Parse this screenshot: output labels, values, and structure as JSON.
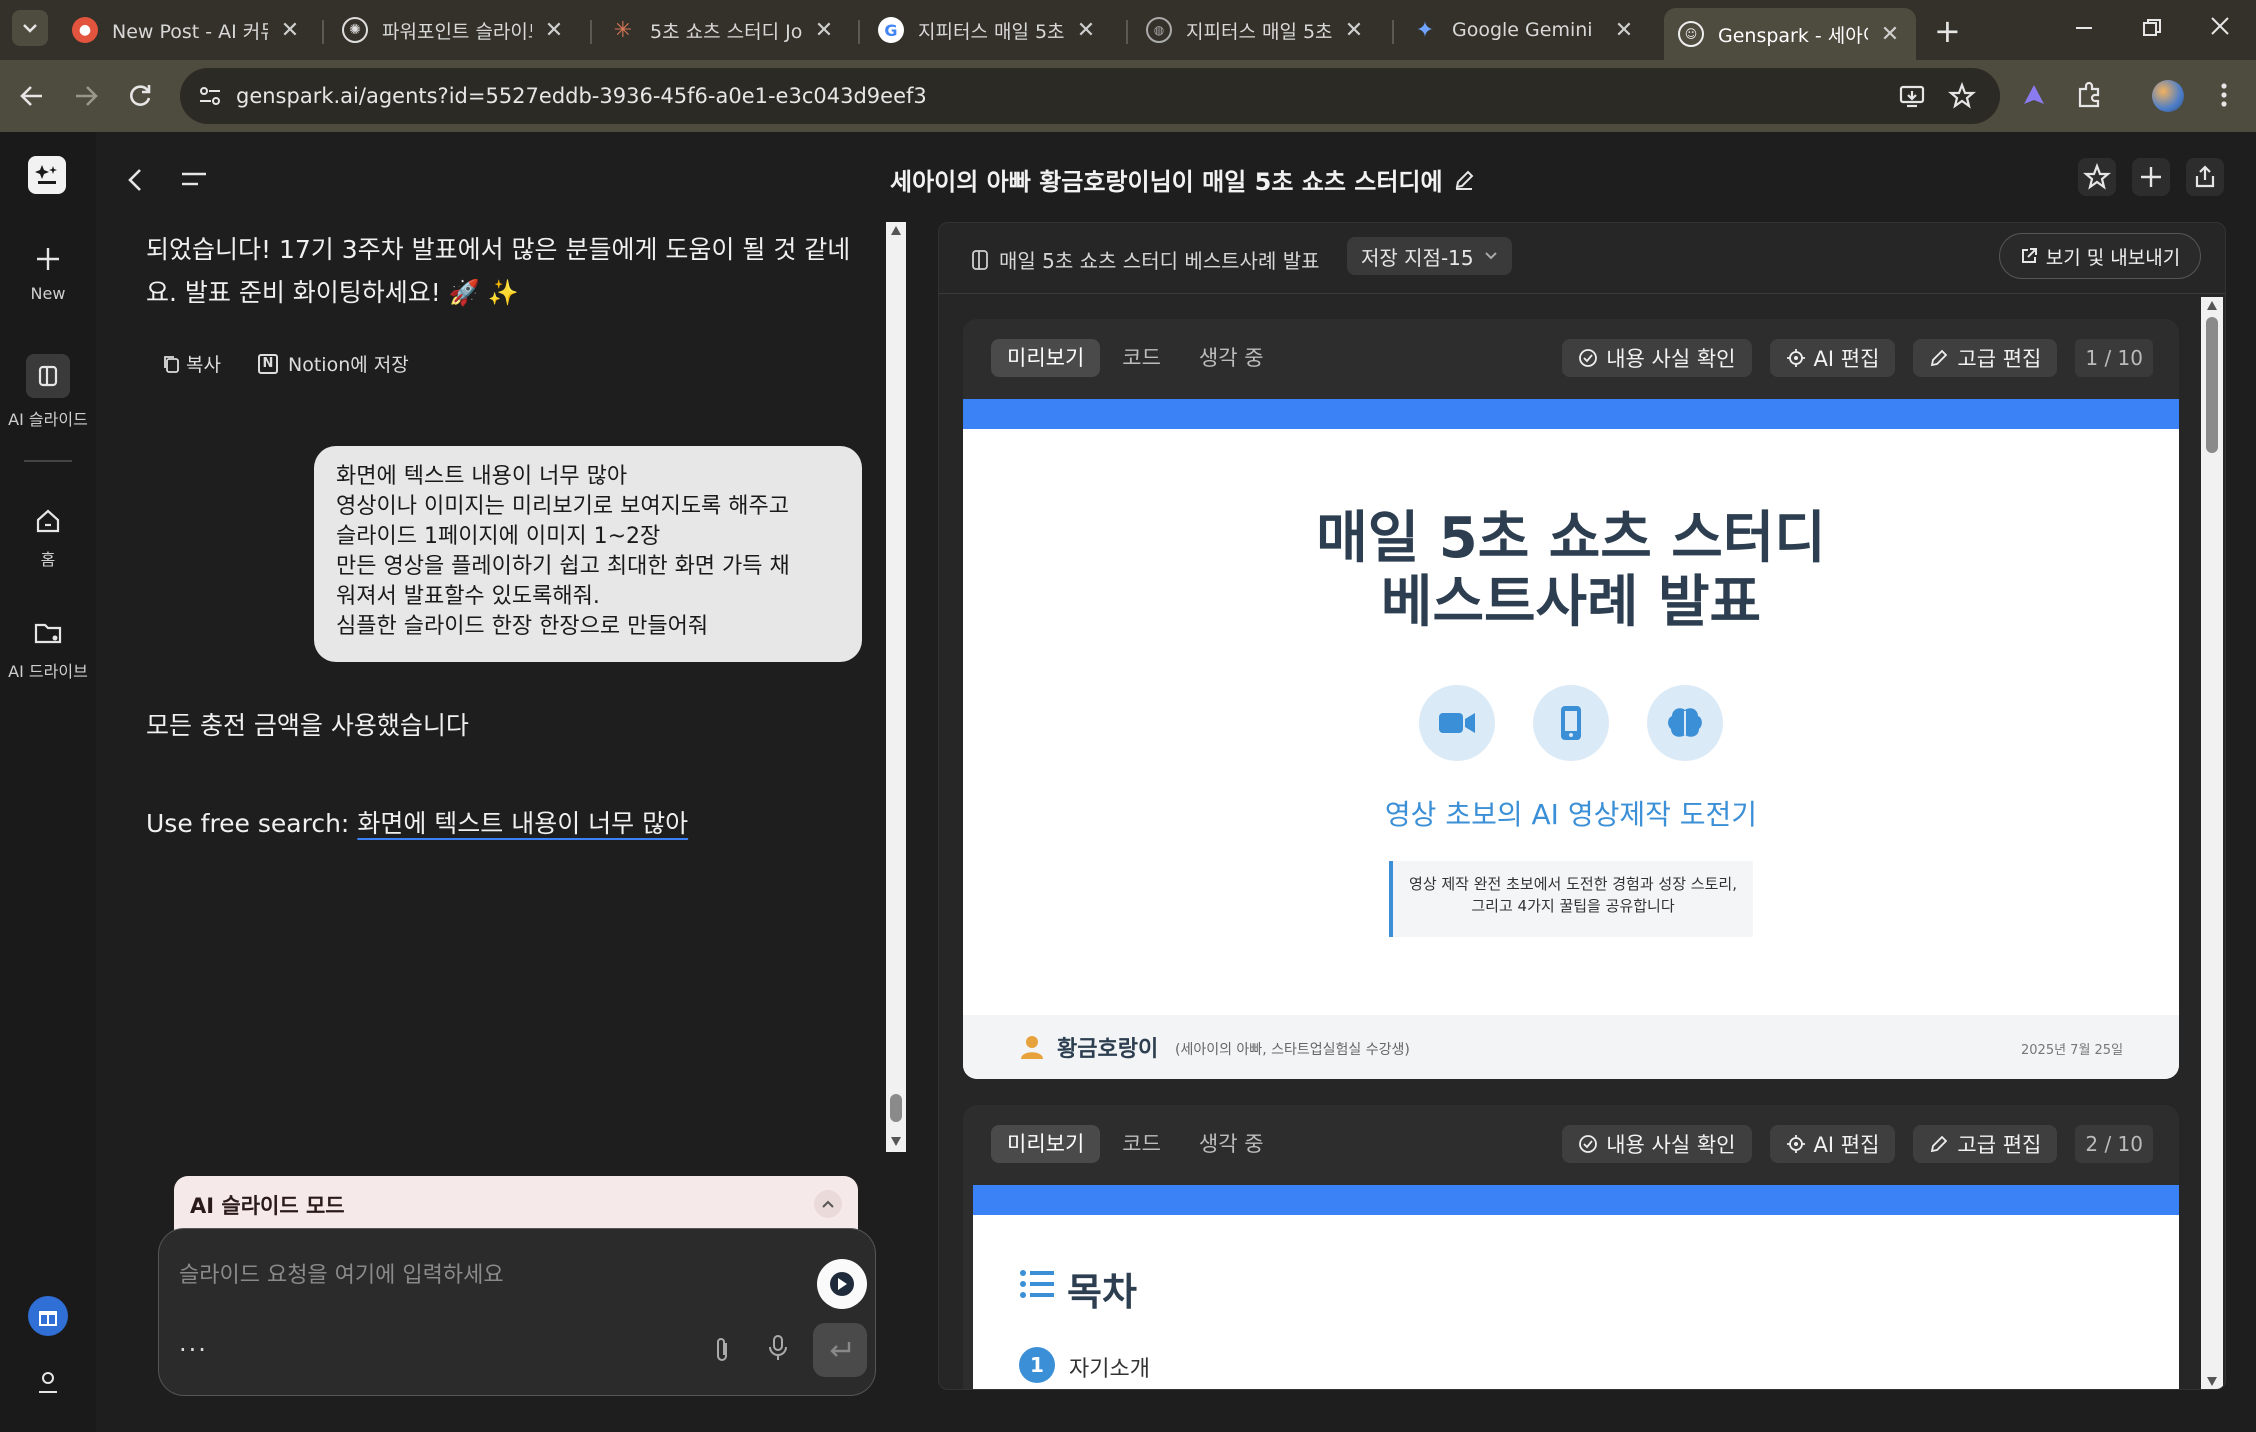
{
  "browser": {
    "tabs": [
      {
        "label": "New Post - AI 커뮤",
        "icon": "red-bubble"
      },
      {
        "label": "파워포인트 슬라이드",
        "icon": "chatgpt"
      },
      {
        "label": "5초 쇼츠 스터디 Jo",
        "icon": "claude-star"
      },
      {
        "label": "지피터스 매일 5초",
        "icon": "google-g"
      },
      {
        "label": "지피터스 매일 5초",
        "icon": "globe"
      },
      {
        "label": "Google Gemini",
        "icon": "gemini-star"
      },
      {
        "label": "Genspark - 세아이의",
        "icon": "genspark"
      }
    ],
    "url": "genspark.ai/agents?id=5527eddb-3936-45f6-a0e1-e3c043d9eef3"
  },
  "rail": {
    "new": "New",
    "ai_slides": "AI 슬라이드",
    "home": "홈",
    "ai_drive": "AI 드라이브"
  },
  "header": {
    "title": "세아이의 아빠 황금호랑이님이 매일 5초 쇼츠 스터디에"
  },
  "chat": {
    "assistant_msg": "되었습니다! 17기 3주차 발표에서 많은 분들에게 도움이 될 것 같네요. 발표 준비 화이팅하세요! 🚀 ✨",
    "copy": "복사",
    "notion": "Notion에 저장",
    "user_msg": [
      "화면에 텍스트 내용이 너무 많아",
      "영상이나 이미지는 미리보기로 보여지도록 해주고",
      "슬라이드 1페이지에 이미지 1~2장",
      "만든 영상을 플레이하기 쉽고 최대한 화면 가득 채",
      "워져서 발표할수 있도록해줘.",
      "심플한 슬라이드 한장 한장으로 만들어줘"
    ],
    "credit_msg": "모든 충전 금액을 사용했습니다",
    "free_search_prefix": "Use free search: ",
    "free_search_link": "화면에 텍스트 내용이 너무 많아",
    "mode_label": "AI 슬라이드 모드",
    "input_placeholder": "슬라이드 요청을 여기에 입력하세요",
    "more": "..."
  },
  "panel": {
    "doc_title": "매일 5초 쇼츠 스터디 베스트사례 발표",
    "save_point": "저장 지점-15",
    "export": "보기 및 내보내기",
    "tabs": [
      "미리보기",
      "코드",
      "생각 중"
    ],
    "fact_check": "내용 사실 확인",
    "ai_edit": "AI 편집",
    "adv_edit": "고급 편집",
    "slide1": {
      "page": "1 / 10",
      "title_line1": "매일 5초 쇼츠 스터디",
      "title_line2": "베스트사례 발표",
      "subtitle": "영상 초보의 AI 영상제작 도전기",
      "desc_line1": "영상 제작 완전 초보에서 도전한 경험과 성장 스토리,",
      "desc_line2": "그리고 4가지 꿀팁을 공유합니다",
      "author": "황금호랑이",
      "author_note": "(세아이의 아빠, 스타트업실험실 수강생)",
      "date": "2025년 7월 25일",
      "accent": "#3b82f6",
      "title_color": "#2c3e50",
      "subtitle_color": "#3a8fd6"
    },
    "slide2": {
      "page": "2 / 10",
      "toc_title": "목차",
      "item1_num": "1",
      "item1": "자기소개"
    }
  }
}
